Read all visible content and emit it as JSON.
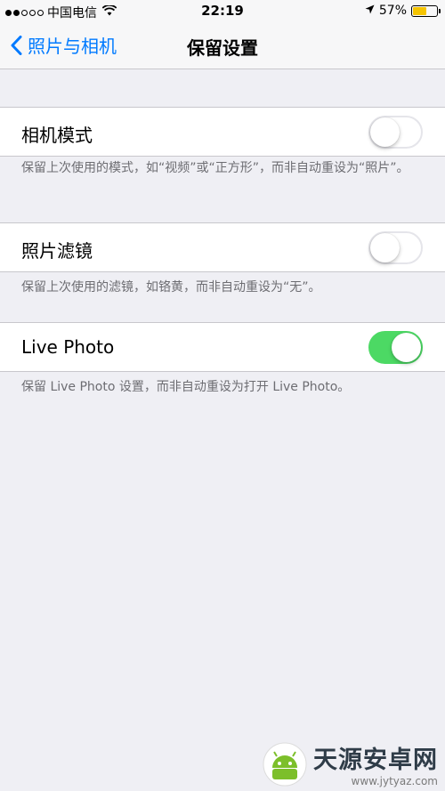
{
  "status_bar": {
    "carrier": "中国电信",
    "time": "22:19",
    "battery_percent": "57%",
    "battery_level": 0.57
  },
  "nav": {
    "back_label": "照片与相机",
    "title": "保留设置"
  },
  "settings": [
    {
      "label": "相机模式",
      "on": false,
      "footnote": "保留上次使用的模式，如“视频”或“正方形”，而非自动重设为“照片”。"
    },
    {
      "label": "照片滤镜",
      "on": false,
      "footnote": "保留上次使用的滤镜，如铬黄，而非自动重设为“无”。"
    },
    {
      "label": "Live Photo",
      "on": true,
      "footnote": "保留 Live Photo 设置，而非自动重设为打开 Live Photo。"
    }
  ],
  "watermark": {
    "title": "天源安卓网",
    "url": "www.jytyaz.com"
  },
  "colors": {
    "accent": "#007aff",
    "toggle_on": "#4cd964",
    "battery": "#f5c400"
  }
}
